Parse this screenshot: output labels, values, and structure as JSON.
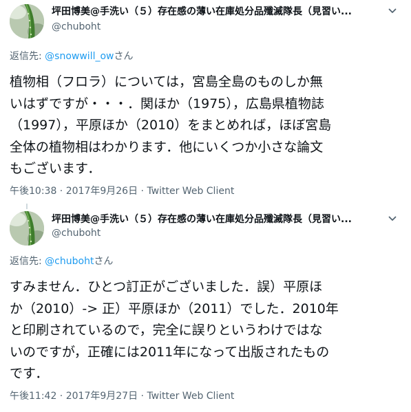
{
  "tweets": [
    {
      "display_name": "坪田博美@手洗い（５）存在感の薄い在庫処分品殲滅隊長（見習い...",
      "handle": "@chuboht",
      "reply_prefix": "返信先: ",
      "reply_mention": "@snowwill_ow",
      "reply_suffix": "さん",
      "body_lines": [
        "植物相（フロラ）については，宮島全島のものしか無",
        "いはずですが・・・．関ほか（1975），広島県植物誌",
        "（1997），平原ほか（2010）をまとめれば，ほぼ宮島",
        "全体の植物相はわかります．他にいくつか小さな論文",
        "もございます．"
      ],
      "time": "午後10:38",
      "date": "2017年9月26日",
      "separator": " · ",
      "client": "Twitter Web Client"
    },
    {
      "display_name": "坪田博美@手洗い（５）存在感の薄い在庫処分品殲滅隊長（見習い...",
      "handle": "@chuboht",
      "reply_prefix": "返信先: ",
      "reply_mention": "@chuboht",
      "reply_suffix": "さん",
      "body_lines": [
        "すみません．ひとつ訂正がございました．誤）平原ほ",
        "か（2010）-> 正）平原ほか（2011）でした．2010年",
        "と印刷されているので，完全に誤りというわけではな",
        "いのですが，正確には2011年になって出版されたもの",
        "です．"
      ],
      "time": "午後11:42",
      "date": "2017年9月27日",
      "separator": " · ",
      "client": "Twitter Web Client"
    }
  ],
  "icons": {
    "avatar": "cucumber-photo-avatar",
    "more": "chevron-down-icon"
  },
  "colors": {
    "text": "#0f1419",
    "secondary": "#536471",
    "link": "#1d9bf0"
  }
}
